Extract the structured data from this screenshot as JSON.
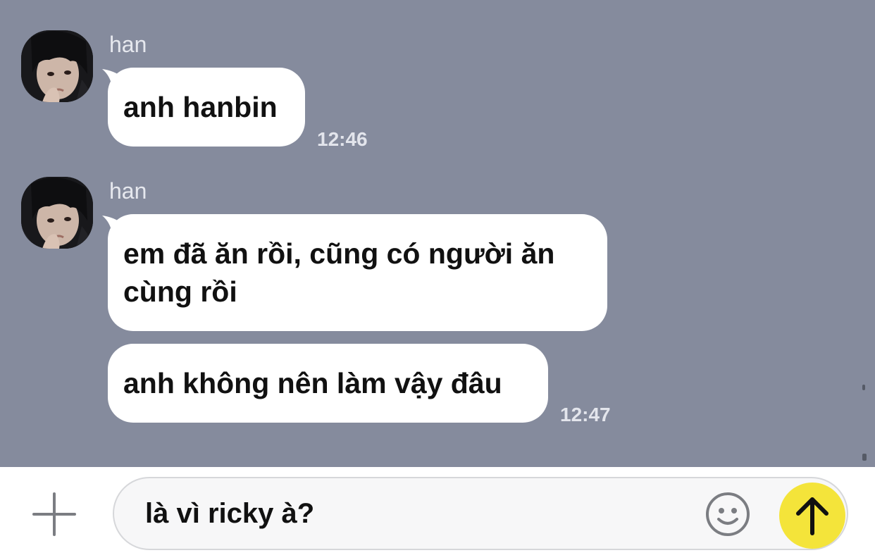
{
  "chat": {
    "messages": [
      {
        "sender": "han",
        "avatar": "profile-photo",
        "text": "anh hanbin",
        "time": "12:46"
      },
      {
        "sender": "han",
        "avatar": "profile-photo",
        "text": "em đã ăn rồi, cũng có người ăn\ncùng rồi",
        "time": ""
      },
      {
        "sender": "",
        "text": "anh không nên làm vậy đâu",
        "time": "12:47"
      }
    ]
  },
  "composer": {
    "plus_icon": "plus-icon",
    "input_value": "là vì ricky à?",
    "emoji_icon": "smiley-face-icon",
    "send_icon": "arrow-up-icon"
  },
  "colors": {
    "chat_background": "#858b9d",
    "bubble": "#ffffff",
    "send_button": "#f4e43a"
  }
}
